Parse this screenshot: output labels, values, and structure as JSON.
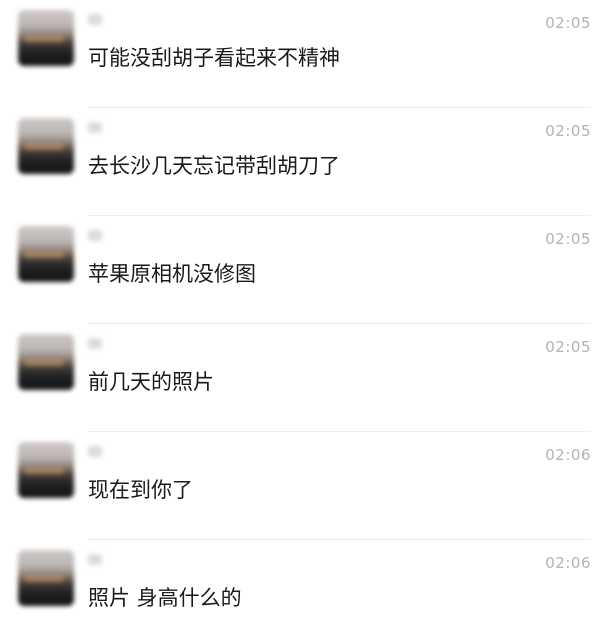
{
  "messages": [
    {
      "time": "02:05",
      "text": "可能没刮胡子看起来不精神"
    },
    {
      "time": "02:05",
      "text": "去长沙几天忘记带刮胡刀了"
    },
    {
      "time": "02:05",
      "text": "苹果原相机没修图"
    },
    {
      "time": "02:05",
      "text": "前几天的照片"
    },
    {
      "time": "02:06",
      "text": "现在到你了"
    },
    {
      "time": "02:06",
      "text": "照片 身高什么的"
    }
  ]
}
